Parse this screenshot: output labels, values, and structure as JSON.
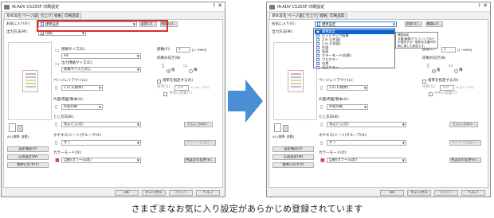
{
  "dialog": {
    "title": "iR-ADV C5255F 印刷設定",
    "help_icon": "?",
    "close_icon": "✕",
    "tabs": [
      "基本設定",
      "ページ設定",
      "仕上げ",
      "給紙",
      "印刷品質"
    ],
    "favorites": {
      "label": "お気に入り(F):",
      "value": "標準設定",
      "add_button": "追加(1)...",
      "edit_button": "編集(2)..."
    },
    "output_method": {
      "label": "出力方法(M):",
      "value": "印刷"
    },
    "original_size": {
      "label": "原稿サイズ(S):",
      "value": "A4"
    },
    "output_size": {
      "label": "出力用紙サイズ(Z):",
      "value": "原稿サイズと同じ"
    },
    "copies": {
      "label": "部数(C):",
      "value": "1",
      "range": "[1~9999]"
    },
    "orientation": {
      "label": "印刷の向き(N)",
      "portrait": "縦",
      "landscape": "横"
    },
    "page_layout": {
      "label": "ページレイアウト(L):",
      "value": "1 in 1(標準)"
    },
    "zoom": {
      "label": "倍率を指定する(R)",
      "value": "100",
      "range": "% [25~200]"
    },
    "fit_page": "中央に配置(T)",
    "duplex": {
      "label": "片面/両面/製本(X):",
      "value": "片面印刷"
    },
    "staple": {
      "label": "とじ方向(B):",
      "value": "長辺とじ(左)",
      "margin_button": "とじしろ(G)..."
    },
    "finishing": {
      "label": "ホチキス/ソート/グループ(H):",
      "value": "オフ",
      "button": "ホチキス位置(I)..."
    },
    "color_mode": {
      "label": "カラーモード(O):",
      "value": "自動(カラー/白黒)",
      "button": "色設定の変更(E)..."
    },
    "preview_caption": "A4 [縮率: 自動]",
    "side_buttons": [
      "設定確認(V)",
      "言語設定(W)",
      "標準に戻す(Y)"
    ],
    "bottom_buttons": [
      "OK",
      "キャンセル",
      "適用(A)",
      "ヘルプ"
    ]
  },
  "favorites_dropdown": {
    "items": [
      "標準設定",
      "ビットマップ画像",
      "2 in 1(片面)",
      "2 in 1(両面)",
      "片面",
      "両面",
      "カラーモード(白黒)",
      "フルカラー",
      "白黒",
      "光沢エラー"
    ]
  },
  "tooltip": {
    "title": "標準設定",
    "description": "文書/画像/グラフィックなどの混在する一般的な文書の印刷に適した設定です。"
  },
  "caption": "さまざまなお気に入り設定があらかじめ登録されています",
  "colors": {
    "arrow": "#4b8ed6",
    "highlight": "#0a64d8",
    "red_box": "#e02a2a"
  }
}
